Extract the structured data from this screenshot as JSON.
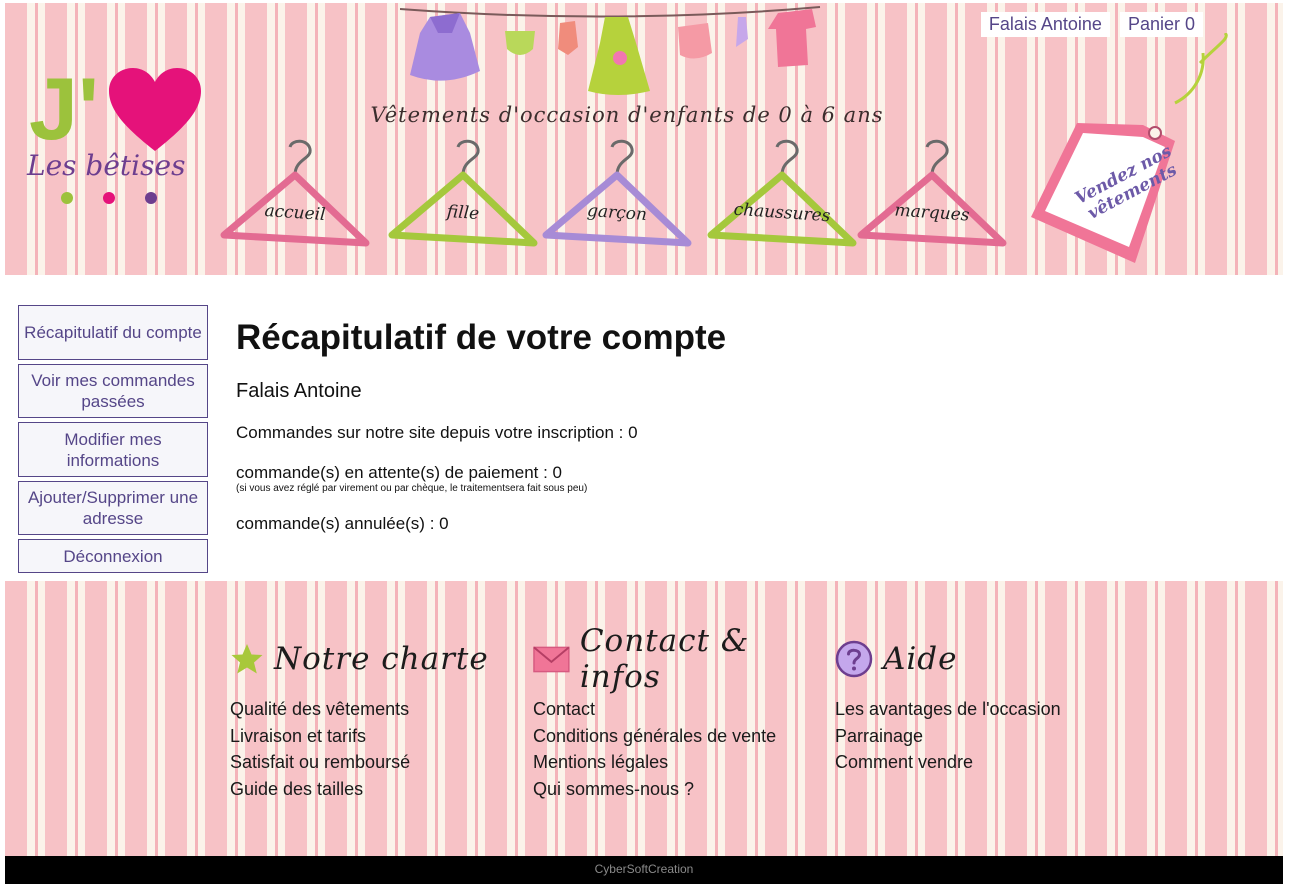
{
  "header": {
    "logo": {
      "mark": "J'",
      "subtitle": "Les bêtises"
    },
    "tagline": "Vêtements d'occasion d'enfants de 0 à 6 ans",
    "nav": [
      {
        "label": "accueil"
      },
      {
        "label": "fille"
      },
      {
        "label": "garçon"
      },
      {
        "label": "chaussures"
      },
      {
        "label": "marques"
      }
    ],
    "user_link": "Falais Antoine",
    "cart_link": "Panier 0",
    "sell_tag": "Vendez nos vêtements"
  },
  "sidebar": {
    "items": [
      {
        "label": "Récapitulatif du compte"
      },
      {
        "label": "Voir mes commandes passées"
      },
      {
        "label": "Modifier mes informations"
      },
      {
        "label": "Ajouter/Supprimer une adresse"
      },
      {
        "label": "Déconnexion"
      }
    ]
  },
  "main": {
    "title": "Récapitulatif de votre compte",
    "user_name": "Falais Antoine",
    "orders_since_signup": "Commandes sur notre site depuis votre inscription : 0",
    "pending_payment": "commande(s) en attente(s) de paiement : 0",
    "pending_note": "(si vous avez réglé par virement ou par chèque, le traitementsera fait sous peu)",
    "cancelled": "commande(s) annulée(s) : 0"
  },
  "footer": {
    "columns": [
      {
        "title": "Notre charte",
        "icon": "star-icon",
        "links": [
          "Qualité des vêtements",
          "Livraison et tarifs",
          "Satisfait ou remboursé",
          "Guide des tailles"
        ]
      },
      {
        "title": "Contact & infos",
        "icon": "envelope-icon",
        "links": [
          "Contact",
          "Conditions générales de vente",
          "Mentions légales",
          "Qui sommes-nous ?"
        ]
      },
      {
        "title": "Aide",
        "icon": "question-icon",
        "links": [
          "Les avantages de l'occasion",
          "Parrainage",
          "Comment vendre"
        ]
      }
    ],
    "credits": "CyberSoftCreation"
  },
  "colors": {
    "link_purple": "#554688",
    "stripe_pink": "#f7c2c6",
    "stripe_cream": "#fbf3ea",
    "logo_green": "#9cc23c",
    "logo_pink": "#e5127a",
    "logo_purple": "#6d3e8f"
  }
}
